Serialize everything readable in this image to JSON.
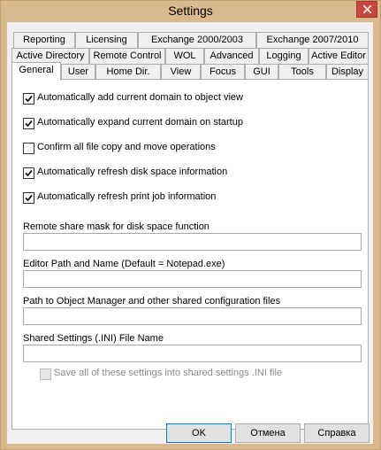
{
  "window": {
    "title": "Settings"
  },
  "tabs": {
    "row1": [
      {
        "id": "reporting",
        "label": "Reporting"
      },
      {
        "id": "licensing",
        "label": "Licensing"
      },
      {
        "id": "exchange-2000-2003",
        "label": "Exchange 2000/2003"
      },
      {
        "id": "exchange-2007-2010",
        "label": "Exchange 2007/2010"
      }
    ],
    "row2": [
      {
        "id": "active-directory",
        "label": "Active Directory"
      },
      {
        "id": "remote-control",
        "label": "Remote Control"
      },
      {
        "id": "wol",
        "label": "WOL"
      },
      {
        "id": "advanced",
        "label": "Advanced"
      },
      {
        "id": "logging",
        "label": "Logging"
      },
      {
        "id": "active-editor",
        "label": "Active Editor"
      }
    ],
    "row3": [
      {
        "id": "general",
        "label": "General",
        "active": true
      },
      {
        "id": "user",
        "label": "User"
      },
      {
        "id": "home-dir",
        "label": "Home Dir."
      },
      {
        "id": "view",
        "label": "View"
      },
      {
        "id": "focus",
        "label": "Focus"
      },
      {
        "id": "gui",
        "label": "GUI"
      },
      {
        "id": "tools",
        "label": "Tools"
      },
      {
        "id": "display",
        "label": "Display"
      }
    ]
  },
  "general": {
    "options": [
      {
        "label": "Automatically add current domain to object view",
        "checked": true
      },
      {
        "label": "Automatically expand current domain on startup",
        "checked": true
      },
      {
        "label": "Confirm all file copy and move operations",
        "checked": false
      },
      {
        "label": "Automatically refresh disk space information",
        "checked": true
      },
      {
        "label": "Automatically refresh print job information",
        "checked": true
      }
    ],
    "fields": [
      {
        "label": "Remote share mask for disk space function",
        "value": ""
      },
      {
        "label": "Editor Path and Name (Default = Notepad.exe)",
        "value": ""
      },
      {
        "label": "Path to Object Manager and other shared configuration files",
        "value": ""
      },
      {
        "label": "Shared Settings (.INI) File Name",
        "value": ""
      }
    ],
    "save_shared": {
      "label": "Save all of these settings into shared settings .INI file",
      "checked": false,
      "disabled": true
    }
  },
  "buttons": {
    "ok": "OK",
    "cancel": "Отмена",
    "help": "Справка"
  }
}
